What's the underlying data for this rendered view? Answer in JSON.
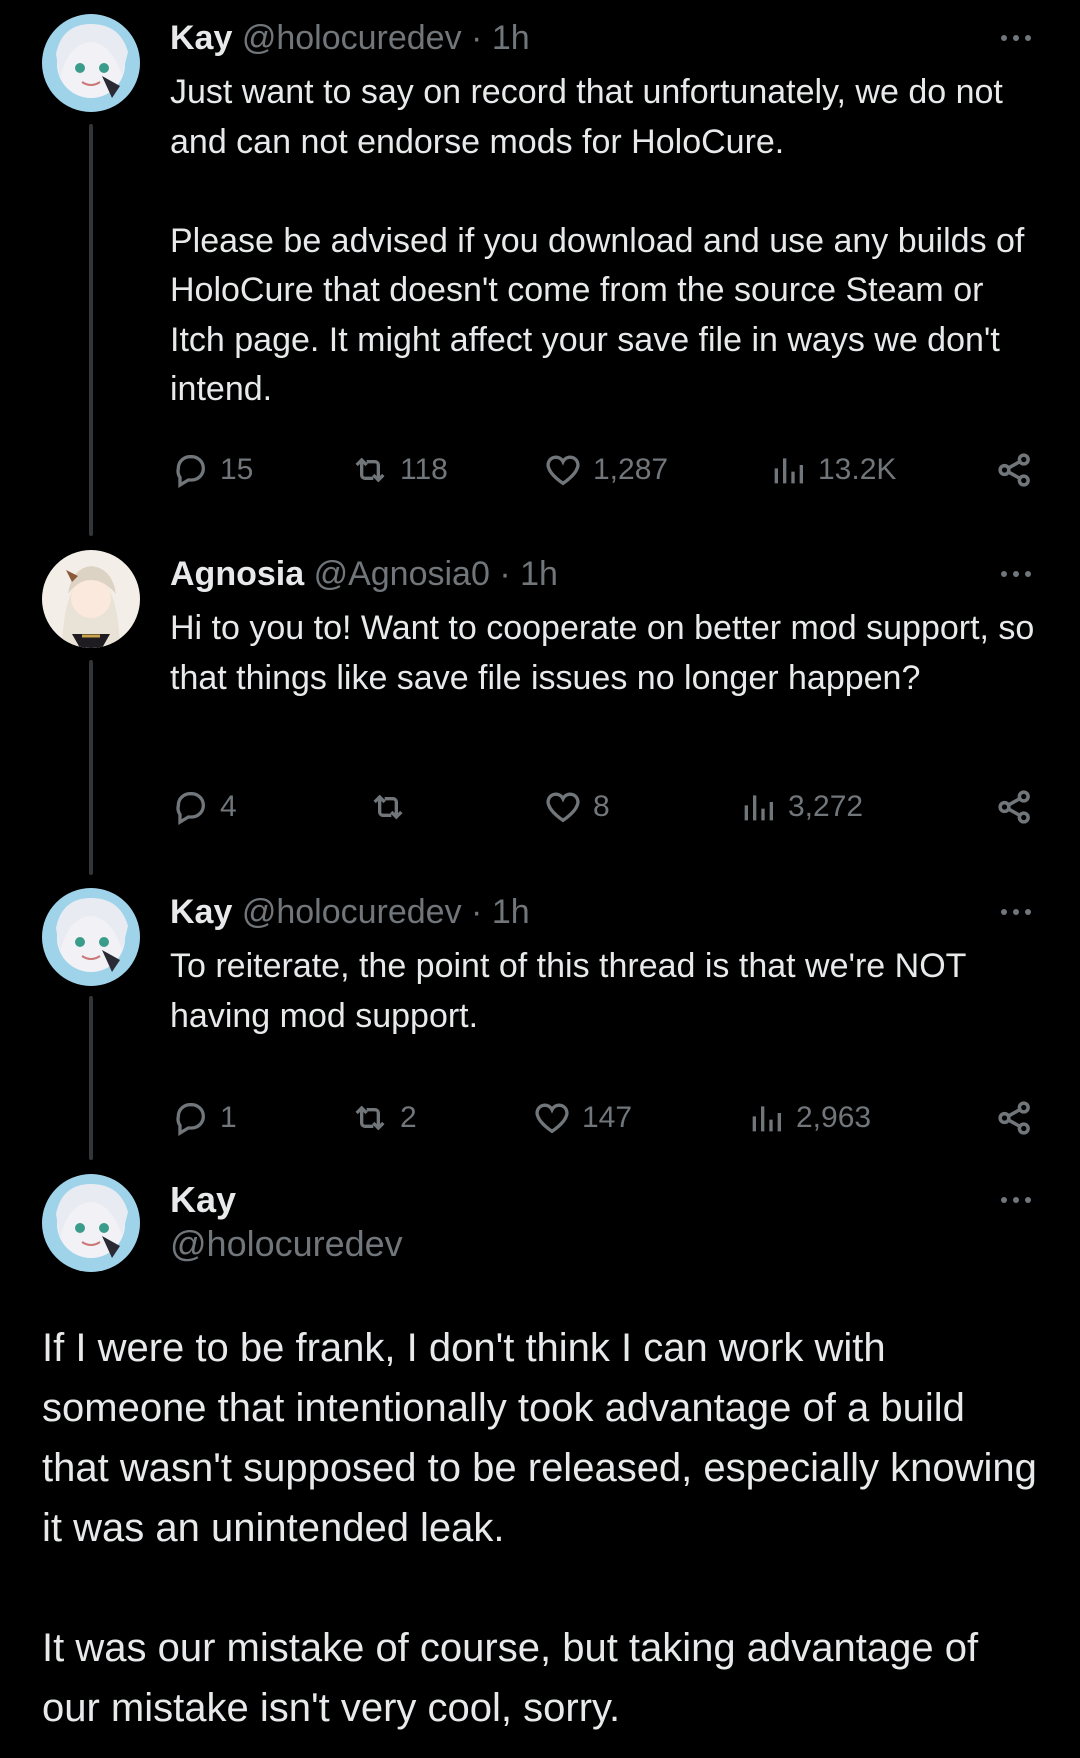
{
  "tweets": [
    {
      "name": "Kay",
      "handle": "@holocuredev",
      "separator": "·",
      "time": "1h",
      "text": "Just want to say on record that unfortunately, we do not and can not endorse mods for HoloCure.\n\nPlease be advised if you download and use any builds of HoloCure that doesn't come from the source Steam or Itch page. It might affect your save file in ways we don't intend.",
      "replies": "15",
      "reposts": "118",
      "likes": "1,287",
      "views": "13.2K"
    },
    {
      "name": "Agnosia",
      "handle": "@Agnosia0",
      "separator": "·",
      "time": "1h",
      "text": "Hi to you to! Want to cooperate on better mod support, so that things like save file issues no longer happen?",
      "replies": "4",
      "reposts": "",
      "likes": "8",
      "views": "3,272"
    },
    {
      "name": "Kay",
      "handle": "@holocuredev",
      "separator": "·",
      "time": "1h",
      "text": "To reiterate, the point of this thread is that we're NOT having mod support.",
      "replies": "1",
      "reposts": "2",
      "likes": "147",
      "views": "2,963"
    }
  ],
  "main": {
    "name": "Kay",
    "handle": "@holocuredev",
    "text": "If I were to be frank, I don't think I can work with someone that intentionally took advantage of a build that wasn't supposed to be released, especially knowing it was an unintended leak.\n\nIt was our mistake of course, but taking advantage of our mistake isn't very cool, sorry."
  },
  "icons": {
    "reply": "reply-icon",
    "repost": "repost-icon",
    "like": "heart-icon",
    "views": "views-icon",
    "share": "share-icon",
    "more": "more-icon"
  },
  "colors": {
    "background": "#000000",
    "text": "#e7e9ea",
    "muted": "#71767b",
    "thread_line": "#333639"
  }
}
